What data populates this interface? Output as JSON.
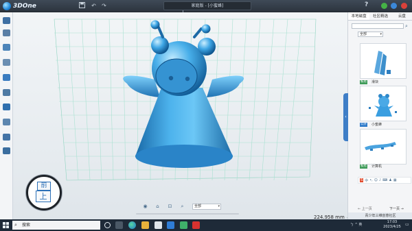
{
  "app": {
    "name": "3DOne",
    "window_title": "家庭版 - [小蜜蜂]",
    "help_label": "?"
  },
  "right_panel": {
    "tabs": [
      "本地磁盘",
      "社区精选",
      "云盘"
    ],
    "active_tab": 0,
    "search": {
      "placeholder": "",
      "value": ""
    },
    "filter_value": "全部",
    "items": [
      {
        "badge": "私有",
        "name": "滑块"
      },
      {
        "badge": "公开",
        "name": "小蜜蜂"
      },
      {
        "badge": "私有",
        "name": "计算机"
      }
    ],
    "pager": {
      "prev": "← 上一页",
      "next": "下一页 →"
    },
    "community_label": "青少年三维创意社区"
  },
  "viewcube": {
    "top_face": "前",
    "front_face": "上"
  },
  "render_mode": "全部",
  "status": {
    "measurement": "224.958 mm",
    "unit_caret": "⌄"
  },
  "taskbar": {
    "search_placeholder": "搜索",
    "time": "17:03",
    "date": "2023/4/25",
    "tray_text": "ㄅ ^ 英"
  },
  "colors": {
    "title_bar": "#2c343e",
    "model_blue": "#3f9fdf",
    "accent": "#3e7ec7",
    "taskbar": "#1e2a38"
  }
}
